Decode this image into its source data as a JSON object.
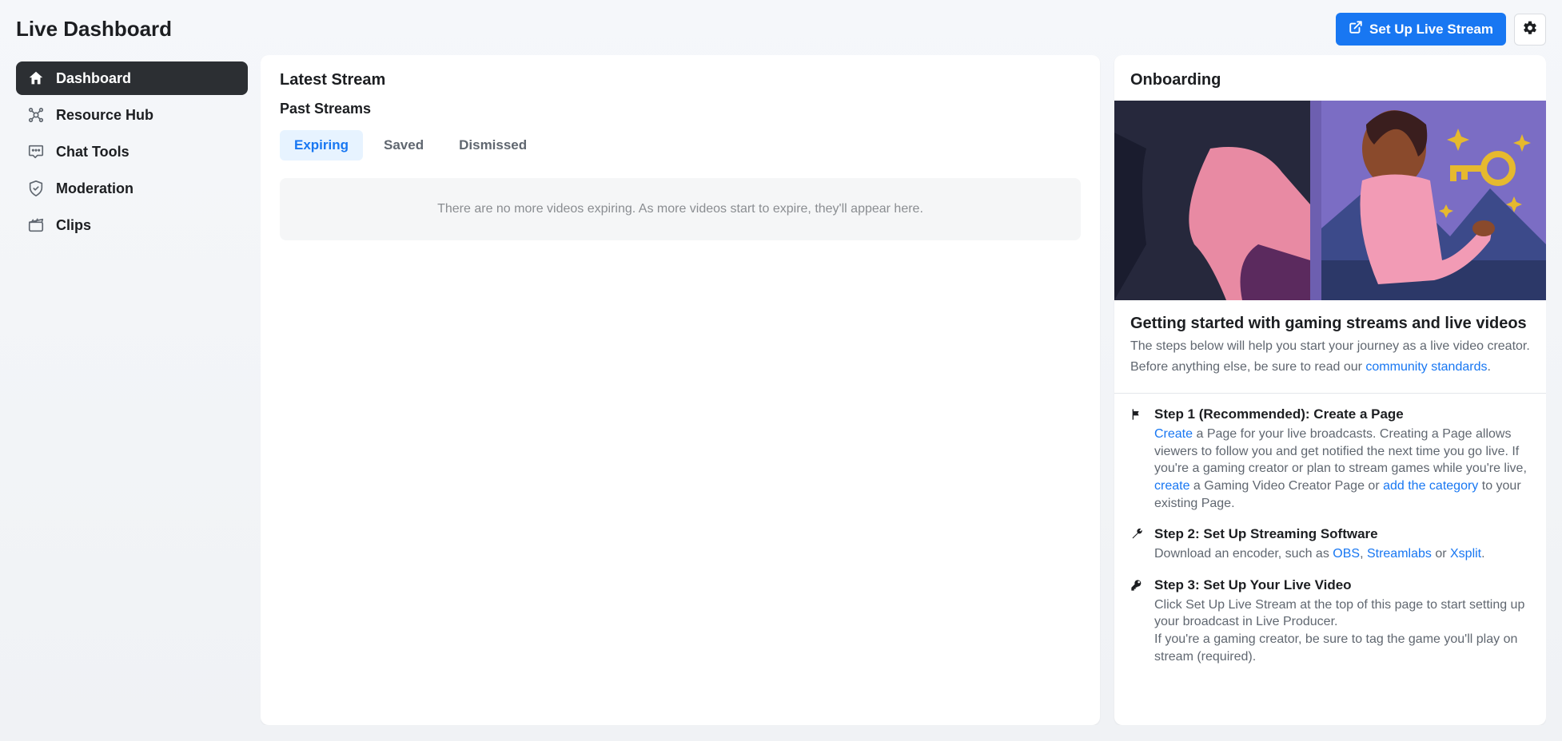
{
  "header": {
    "title": "Live Dashboard",
    "setup_button": "Set Up Live Stream"
  },
  "sidebar": {
    "items": [
      {
        "label": "Dashboard",
        "icon": "home-icon",
        "active": true
      },
      {
        "label": "Resource Hub",
        "icon": "resource-icon",
        "active": false
      },
      {
        "label": "Chat Tools",
        "icon": "chat-icon",
        "active": false
      },
      {
        "label": "Moderation",
        "icon": "shield-icon",
        "active": false
      },
      {
        "label": "Clips",
        "icon": "clapper-icon",
        "active": false
      }
    ]
  },
  "main": {
    "latest_heading": "Latest Stream",
    "past_heading": "Past Streams",
    "tabs": [
      {
        "label": "Expiring",
        "active": true
      },
      {
        "label": "Saved",
        "active": false
      },
      {
        "label": "Dismissed",
        "active": false
      }
    ],
    "empty_message": "There are no more videos expiring. As more videos start to expire, they'll appear here."
  },
  "onboarding": {
    "heading": "Onboarding",
    "title": "Getting started with gaming streams and live videos",
    "intro1": "The steps below will help you start your journey as a live video creator.",
    "intro2_prefix": "Before anything else, be sure to read our ",
    "intro2_link": "community standards",
    "intro2_suffix": ".",
    "steps": [
      {
        "title": "Step 1 (Recommended): Create a Page",
        "link1": "Create",
        "text1": " a Page for your live broadcasts. Creating a Page allows viewers to follow you and get notified the next time you go live. If you're a gaming creator or plan to stream games while you're live, ",
        "link2": "create",
        "text2": " a Gaming Video Creator Page or ",
        "link3": "add the category",
        "text3": " to your existing Page."
      },
      {
        "title": "Step 2: Set Up Streaming Software",
        "text1": "Download an encoder, such as ",
        "link1": "OBS",
        "sep1": ", ",
        "link2": "Streamlabs",
        "sep2": " or ",
        "link3": "Xsplit",
        "text_end": "."
      },
      {
        "title": "Step 3: Set Up Your Live Video",
        "text1": "Click Set Up Live Stream at the top of this page to start setting up your broadcast in Live Producer.",
        "text2": "If you're a gaming creator, be sure to tag the game you'll play on stream (required)."
      }
    ]
  }
}
